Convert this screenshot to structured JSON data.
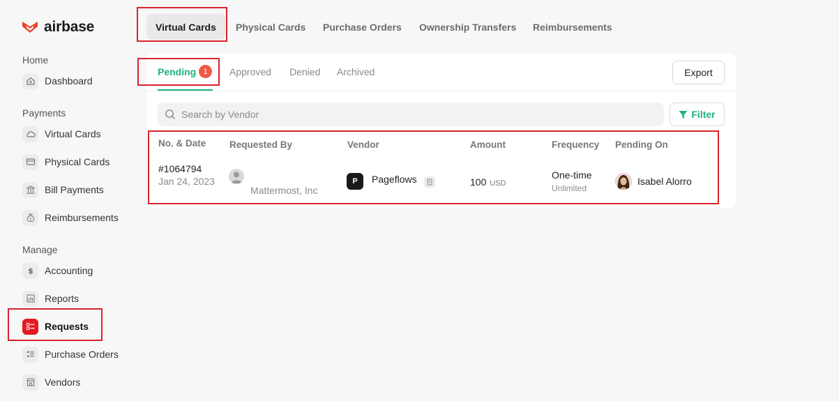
{
  "brand": {
    "name": "airbase",
    "color": "#e8452c"
  },
  "sidebar": {
    "sections": [
      {
        "label": "Home",
        "items": [
          {
            "label": "Dashboard",
            "icon": "home-icon"
          }
        ]
      },
      {
        "label": "Payments",
        "items": [
          {
            "label": "Virtual Cards",
            "icon": "cloud-icon"
          },
          {
            "label": "Physical Cards",
            "icon": "credit-card-icon"
          },
          {
            "label": "Bill Payments",
            "icon": "bank-icon"
          },
          {
            "label": "Reimbursements",
            "icon": "money-bag-icon"
          }
        ]
      },
      {
        "label": "Manage",
        "items": [
          {
            "label": "Accounting",
            "icon": "dollar-icon"
          },
          {
            "label": "Reports",
            "icon": "bar-chart-icon"
          },
          {
            "label": "Requests",
            "icon": "checklist-icon",
            "active": true
          },
          {
            "label": "Purchase Orders",
            "icon": "list-icon"
          },
          {
            "label": "Vendors",
            "icon": "store-icon"
          }
        ]
      }
    ]
  },
  "top_tabs": [
    {
      "label": "Virtual Cards",
      "active": true
    },
    {
      "label": "Physical Cards"
    },
    {
      "label": "Purchase Orders"
    },
    {
      "label": "Ownership Transfers"
    },
    {
      "label": "Reimbursements"
    }
  ],
  "sub_tabs": [
    {
      "label": "Pending",
      "active": true,
      "badge": "1"
    },
    {
      "label": "Approved"
    },
    {
      "label": "Denied"
    },
    {
      "label": "Archived"
    }
  ],
  "export_label": "Export",
  "search": {
    "placeholder": "Search by Vendor"
  },
  "filter_label": "Filter",
  "table": {
    "columns": [
      "No. & Date",
      "Requested By",
      "Vendor",
      "Amount",
      "Frequency",
      "Pending On"
    ],
    "rows": [
      {
        "number": "#1064794",
        "date": "Jan 24, 2023",
        "requested_by": "Mattermost, Inc",
        "vendor_initial": "P",
        "vendor": "Pageflows",
        "amount": "100",
        "currency": "USD",
        "frequency": "One-time",
        "frequency_sub": "Unlimited",
        "pending_on": "Isabel Alorro"
      }
    ]
  },
  "colors": {
    "accent_green": "#1fb27a",
    "highlight_red": "#d9232b",
    "badge": "#ef5a45"
  }
}
